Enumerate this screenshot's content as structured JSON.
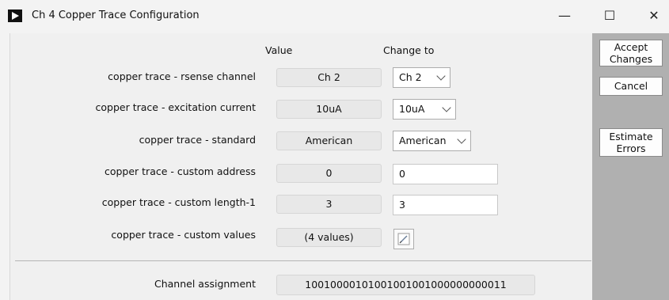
{
  "window": {
    "title": "Ch 4 Copper Trace Configuration",
    "minimize": "—",
    "maximize": "☐",
    "close": "✕"
  },
  "headers": {
    "value": "Value",
    "change_to": "Change to"
  },
  "rows": [
    {
      "label": "copper trace - rsense channel",
      "value": "Ch 2",
      "control": "select",
      "change": "Ch 2"
    },
    {
      "label": "copper trace - excitation current",
      "value": "10uA",
      "control": "select",
      "change": "10uA"
    },
    {
      "label": "copper trace - standard",
      "value": "American",
      "control": "select",
      "change": "American"
    },
    {
      "label": "copper trace - custom address",
      "value": "0",
      "control": "text",
      "change": "0"
    },
    {
      "label": "copper trace - custom length-1",
      "value": "3",
      "control": "text",
      "change": "3"
    },
    {
      "label": "copper trace - custom values",
      "value": "(4 values)",
      "control": "edit-button",
      "change": ""
    }
  ],
  "channel_assignment": {
    "label": "Channel assignment",
    "value": "10010000101001001001000000000011"
  },
  "buttons": {
    "accept": [
      "Accept",
      "Changes"
    ],
    "cancel": "Cancel",
    "estimate": [
      "Estimate",
      "Errors"
    ]
  }
}
